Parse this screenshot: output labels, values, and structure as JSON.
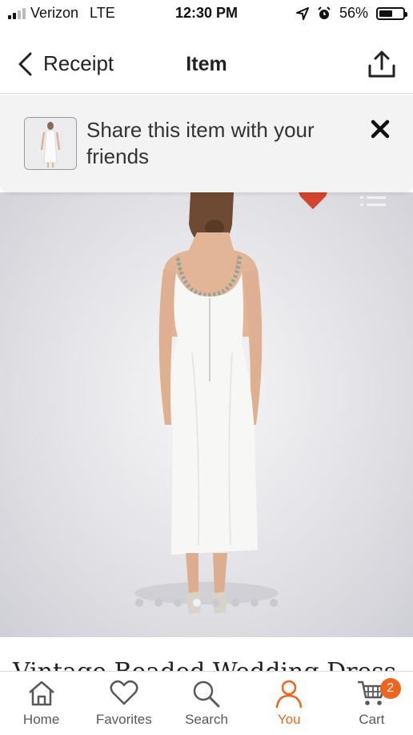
{
  "status_bar": {
    "carrier": "Verizon",
    "network": "LTE",
    "time": "12:30 PM",
    "battery_percent": "56%",
    "battery_level": 0.56
  },
  "nav": {
    "back_label": "Receipt",
    "title": "Item"
  },
  "banner": {
    "message": "Share this item with your friends"
  },
  "product": {
    "title": "Vintage Beaded Wedding Dress",
    "image_page_count": 8,
    "active_image_index": 3
  },
  "tabs": [
    {
      "label": "Home",
      "icon": "home-icon"
    },
    {
      "label": "Favorites",
      "icon": "heart-icon"
    },
    {
      "label": "Search",
      "icon": "search-icon"
    },
    {
      "label": "You",
      "icon": "person-icon"
    },
    {
      "label": "Cart",
      "icon": "cart-icon"
    }
  ],
  "active_tab": "You",
  "cart_badge": "2",
  "colors": {
    "accent": "#f1641e",
    "favorite": "#d3452c"
  }
}
